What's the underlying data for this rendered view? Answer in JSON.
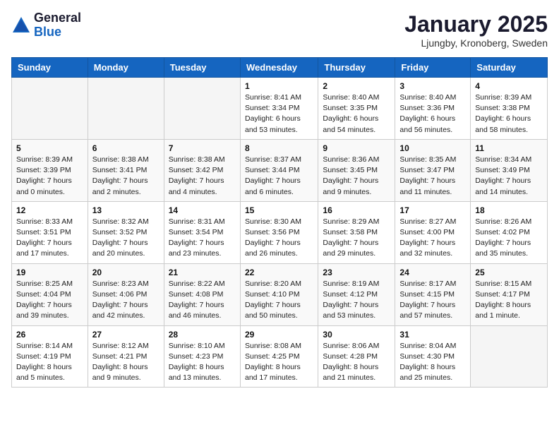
{
  "logo": {
    "text_general": "General",
    "text_blue": "Blue"
  },
  "title": "January 2025",
  "location": "Ljungby, Kronoberg, Sweden",
  "days_of_week": [
    "Sunday",
    "Monday",
    "Tuesday",
    "Wednesday",
    "Thursday",
    "Friday",
    "Saturday"
  ],
  "weeks": [
    [
      {
        "day": "",
        "info": ""
      },
      {
        "day": "",
        "info": ""
      },
      {
        "day": "",
        "info": ""
      },
      {
        "day": "1",
        "info": "Sunrise: 8:41 AM\nSunset: 3:34 PM\nDaylight: 6 hours\nand 53 minutes."
      },
      {
        "day": "2",
        "info": "Sunrise: 8:40 AM\nSunset: 3:35 PM\nDaylight: 6 hours\nand 54 minutes."
      },
      {
        "day": "3",
        "info": "Sunrise: 8:40 AM\nSunset: 3:36 PM\nDaylight: 6 hours\nand 56 minutes."
      },
      {
        "day": "4",
        "info": "Sunrise: 8:39 AM\nSunset: 3:38 PM\nDaylight: 6 hours\nand 58 minutes."
      }
    ],
    [
      {
        "day": "5",
        "info": "Sunrise: 8:39 AM\nSunset: 3:39 PM\nDaylight: 7 hours\nand 0 minutes."
      },
      {
        "day": "6",
        "info": "Sunrise: 8:38 AM\nSunset: 3:41 PM\nDaylight: 7 hours\nand 2 minutes."
      },
      {
        "day": "7",
        "info": "Sunrise: 8:38 AM\nSunset: 3:42 PM\nDaylight: 7 hours\nand 4 minutes."
      },
      {
        "day": "8",
        "info": "Sunrise: 8:37 AM\nSunset: 3:44 PM\nDaylight: 7 hours\nand 6 minutes."
      },
      {
        "day": "9",
        "info": "Sunrise: 8:36 AM\nSunset: 3:45 PM\nDaylight: 7 hours\nand 9 minutes."
      },
      {
        "day": "10",
        "info": "Sunrise: 8:35 AM\nSunset: 3:47 PM\nDaylight: 7 hours\nand 11 minutes."
      },
      {
        "day": "11",
        "info": "Sunrise: 8:34 AM\nSunset: 3:49 PM\nDaylight: 7 hours\nand 14 minutes."
      }
    ],
    [
      {
        "day": "12",
        "info": "Sunrise: 8:33 AM\nSunset: 3:51 PM\nDaylight: 7 hours\nand 17 minutes."
      },
      {
        "day": "13",
        "info": "Sunrise: 8:32 AM\nSunset: 3:52 PM\nDaylight: 7 hours\nand 20 minutes."
      },
      {
        "day": "14",
        "info": "Sunrise: 8:31 AM\nSunset: 3:54 PM\nDaylight: 7 hours\nand 23 minutes."
      },
      {
        "day": "15",
        "info": "Sunrise: 8:30 AM\nSunset: 3:56 PM\nDaylight: 7 hours\nand 26 minutes."
      },
      {
        "day": "16",
        "info": "Sunrise: 8:29 AM\nSunset: 3:58 PM\nDaylight: 7 hours\nand 29 minutes."
      },
      {
        "day": "17",
        "info": "Sunrise: 8:27 AM\nSunset: 4:00 PM\nDaylight: 7 hours\nand 32 minutes."
      },
      {
        "day": "18",
        "info": "Sunrise: 8:26 AM\nSunset: 4:02 PM\nDaylight: 7 hours\nand 35 minutes."
      }
    ],
    [
      {
        "day": "19",
        "info": "Sunrise: 8:25 AM\nSunset: 4:04 PM\nDaylight: 7 hours\nand 39 minutes."
      },
      {
        "day": "20",
        "info": "Sunrise: 8:23 AM\nSunset: 4:06 PM\nDaylight: 7 hours\nand 42 minutes."
      },
      {
        "day": "21",
        "info": "Sunrise: 8:22 AM\nSunset: 4:08 PM\nDaylight: 7 hours\nand 46 minutes."
      },
      {
        "day": "22",
        "info": "Sunrise: 8:20 AM\nSunset: 4:10 PM\nDaylight: 7 hours\nand 50 minutes."
      },
      {
        "day": "23",
        "info": "Sunrise: 8:19 AM\nSunset: 4:12 PM\nDaylight: 7 hours\nand 53 minutes."
      },
      {
        "day": "24",
        "info": "Sunrise: 8:17 AM\nSunset: 4:15 PM\nDaylight: 7 hours\nand 57 minutes."
      },
      {
        "day": "25",
        "info": "Sunrise: 8:15 AM\nSunset: 4:17 PM\nDaylight: 8 hours\nand 1 minute."
      }
    ],
    [
      {
        "day": "26",
        "info": "Sunrise: 8:14 AM\nSunset: 4:19 PM\nDaylight: 8 hours\nand 5 minutes."
      },
      {
        "day": "27",
        "info": "Sunrise: 8:12 AM\nSunset: 4:21 PM\nDaylight: 8 hours\nand 9 minutes."
      },
      {
        "day": "28",
        "info": "Sunrise: 8:10 AM\nSunset: 4:23 PM\nDaylight: 8 hours\nand 13 minutes."
      },
      {
        "day": "29",
        "info": "Sunrise: 8:08 AM\nSunset: 4:25 PM\nDaylight: 8 hours\nand 17 minutes."
      },
      {
        "day": "30",
        "info": "Sunrise: 8:06 AM\nSunset: 4:28 PM\nDaylight: 8 hours\nand 21 minutes."
      },
      {
        "day": "31",
        "info": "Sunrise: 8:04 AM\nSunset: 4:30 PM\nDaylight: 8 hours\nand 25 minutes."
      },
      {
        "day": "",
        "info": ""
      }
    ]
  ]
}
